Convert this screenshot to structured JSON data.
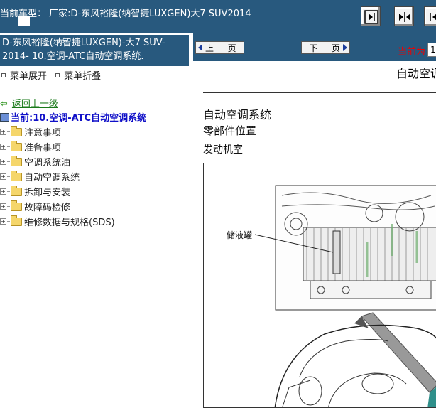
{
  "topbar": {
    "car_info": "当前车型：  厂家:D-东风裕隆(纳智捷LUXGEN)大7 SUV2014"
  },
  "left": {
    "doc_title": "D-东风裕隆(纳智捷LUXGEN)-大7 SUV-2014- 10.空调-ATC自动空调系统.",
    "menu_expand": "菜单展开",
    "menu_collapse": "菜单折叠",
    "back_link": "返回上一级",
    "current": "当前:10.空调-ATC自动空调系统",
    "tree": [
      "注意事项",
      "准备事项",
      "空调系统油",
      "自动空调系统",
      "拆卸与安装",
      "故障码检修",
      "维修数据与规格(SDS)"
    ]
  },
  "right": {
    "prev_label": "上 一 页",
    "next_label": "下 一 页",
    "current_label": "当前为",
    "page_value": "1",
    "running_head": "自动空调",
    "heading1": "自动空调系统",
    "heading2": "零部件位置",
    "heading3": "发动机室",
    "figure_label": "储液罐"
  },
  "colors": {
    "header_blue": "#28597e",
    "link_green": "#1a7a1a",
    "current_blue": "#1010c8",
    "page_red": "#e00000"
  },
  "icons": {
    "nav1": "expand-pane-icon",
    "nav2": "split-pane-icon",
    "nav3": "collapse-pane-icon"
  }
}
